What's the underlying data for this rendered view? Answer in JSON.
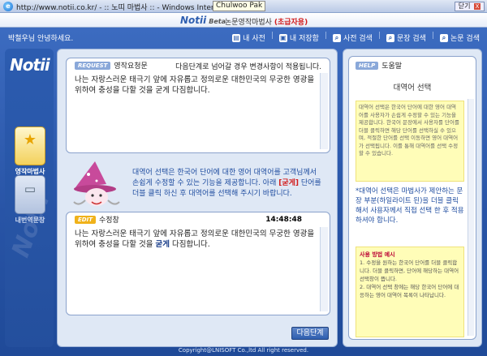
{
  "window": {
    "title": "http://www.notii.co.kr/ - :: 노띠 마법사 :: - Windows Intern",
    "tooltip": "Chulwoo Pak",
    "close_label": "닫기",
    "close_glyph": "X"
  },
  "brand": {
    "logo": "Notii",
    "beta": "Beta",
    "subtitle": "논문영작마법사",
    "level": "(초급자용)"
  },
  "nav": {
    "greeting": "박철우님 안녕하세요.",
    "links": [
      {
        "label": "내 사전",
        "icon": "dictionary-icon"
      },
      {
        "label": "내 저장함",
        "icon": "save-box-icon"
      },
      {
        "label": "사전 검색",
        "icon": "dictionary-search-icon"
      },
      {
        "label": "문장 검색",
        "icon": "sentence-search-icon"
      },
      {
        "label": "논문 검색",
        "icon": "paper-search-icon"
      }
    ]
  },
  "rail": {
    "logo": "Notii",
    "tools": [
      {
        "label": "영작마법사",
        "icon": "star-icon",
        "active": true
      },
      {
        "label": "내번역문장",
        "icon": "document-icon",
        "active": false
      }
    ]
  },
  "request": {
    "tag": "REQUEST",
    "title": "영작요청문",
    "notice": "다음단계로 넘어갈 경우 변경사항이 적용됩니다.",
    "text": "나는 자랑스러운 태극기 앞에 자유롭고 정의로운 대한민국의 무궁한 영광을 위하여 충성을 다할 것을 굳게 다짐합니다."
  },
  "helper": {
    "line1": "대역어 선택은 한국어 단어에 대한 영어 대역어를 고객님께서",
    "line2": "손쉽게 수정할 수 있는 기능을 제공합니다. 아래 ",
    "em": "[굳게]",
    "line2b": " 단어를",
    "line3": "더블 클릭 하신 후 대역어를 선택해 주시기 바랍니다."
  },
  "edit": {
    "tag": "EDIT",
    "title": "수정창",
    "time": "14:48:48",
    "text_before": "나는 자랑스러운 태극기 앞에 자유롭고 정의로운 대한민국의 무궁한 영광을 위하여 충성을 다할 것을 ",
    "highlight": "굳게",
    "text_after": " 다짐합니다."
  },
  "next_label": "다음단계",
  "help": {
    "tag": "HELP",
    "title": "도움말",
    "topic": "대역어 선택",
    "note": "대역어 선택은 한국어 단어에 대한 영어 대역어를 사용자가 손쉽게 수정할 수 있는 기능을 제공합니다. 한국어 문장에서 사용자를 단어를 더블 클릭하면 해당 단어를 선택하실 수 있으며, 적절한 단어를 선택 이동하면 영어 대역어가 선택됩니다. 이를 통해 대역어를 선택 수정할 수 있습니다.",
    "desc": "*대역어 선택은 마법사가 제안하는 문장 부분(하일라이트 된)을 더블 클릭 해서 사용자께서 직접 선택 한 후 적용하셔야 합니다.",
    "example_title": "사용 방법 예시",
    "example_1": "1. 수정을 원하는 한국어 단어를 더블 클릭합니다. 더블 클릭하면, 단어에 해당하는 대역어 선택창이 뜹니다.",
    "example_2": "2. 대역어 선택 창에는 해당 한국어 단어에 대응하는 영어 대역어 목록이 나타납니다."
  },
  "footer": "Copyright@LNISOFT Co.,ltd All right reserved."
}
